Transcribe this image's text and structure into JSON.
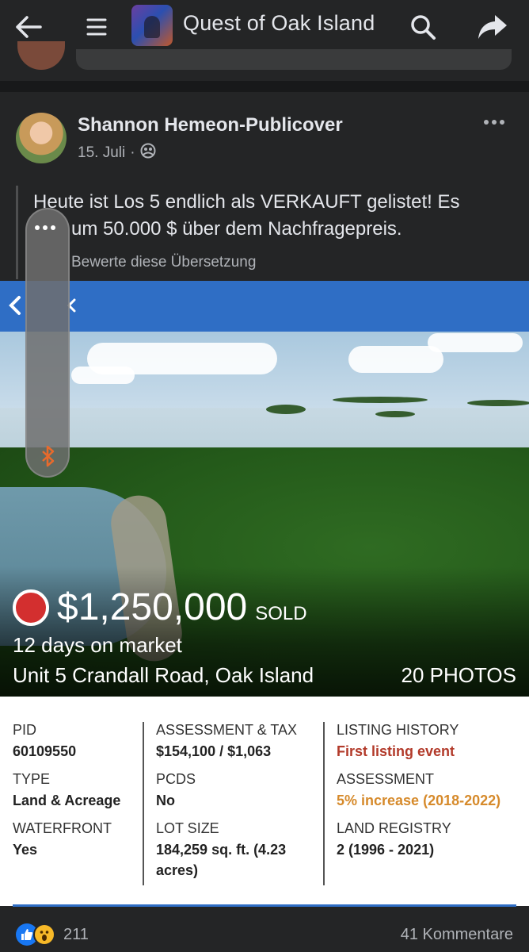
{
  "topbar": {
    "title": "Quest of Oak Island",
    "icons": [
      "back-arrow-icon",
      "menu-icon",
      "search-icon",
      "share-icon"
    ]
  },
  "post": {
    "author": "Shannon Hemeon-Publicover",
    "date": "15. Juli",
    "date_separator": "·",
    "audience_icon": "group-audience-icon",
    "text": "Heute ist Los 5 endlich als VERKAUFT gelistet! Es … um 50.000 $ über dem Nachfragepreis.",
    "text_line1": "Heute ist Los 5 endlich als VERKAUFT gelistet! Es",
    "text_line2": "um 50.000 $ über dem Nachfragepreis.",
    "rate_translation": "Bewerte diese Übersetzung"
  },
  "listing": {
    "price": "$1,250,000",
    "status": "SOLD",
    "days_on_market": "12 days on market",
    "address": "Unit 5 Crandall Road, Oak Island",
    "photos": "20 PHOTOS",
    "status_color": "#d32f2f"
  },
  "details": {
    "col1": [
      {
        "label": "PID",
        "value": "60109550"
      },
      {
        "label": "TYPE",
        "value": "Land & Acreage"
      },
      {
        "label": "WATERFRONT",
        "value": "Yes"
      }
    ],
    "col2": [
      {
        "label": "ASSESSMENT & TAX",
        "value": "$154,100 / $1,063"
      },
      {
        "label": "PCDS",
        "value": "No"
      },
      {
        "label": "LOT SIZE",
        "value": "184,259 sq. ft. (4.23 acres)"
      }
    ],
    "col3": [
      {
        "label": "LISTING HISTORY",
        "value": "First listing event",
        "color": "#b23a2a"
      },
      {
        "label": "ASSESSMENT",
        "value": "5% increase (2018-2022)",
        "color": "#d68a2b"
      },
      {
        "label": "LAND REGISTRY",
        "value": "2 (1996 - 2021)"
      }
    ]
  },
  "footer": {
    "reaction_count": "211",
    "comments": "41 Kommentare",
    "reaction_icons": [
      "like-icon",
      "wow-icon"
    ]
  },
  "colors": {
    "background": "#242526",
    "accent_blue": "#2f6ec5",
    "facebook_blue": "#1877f2"
  }
}
